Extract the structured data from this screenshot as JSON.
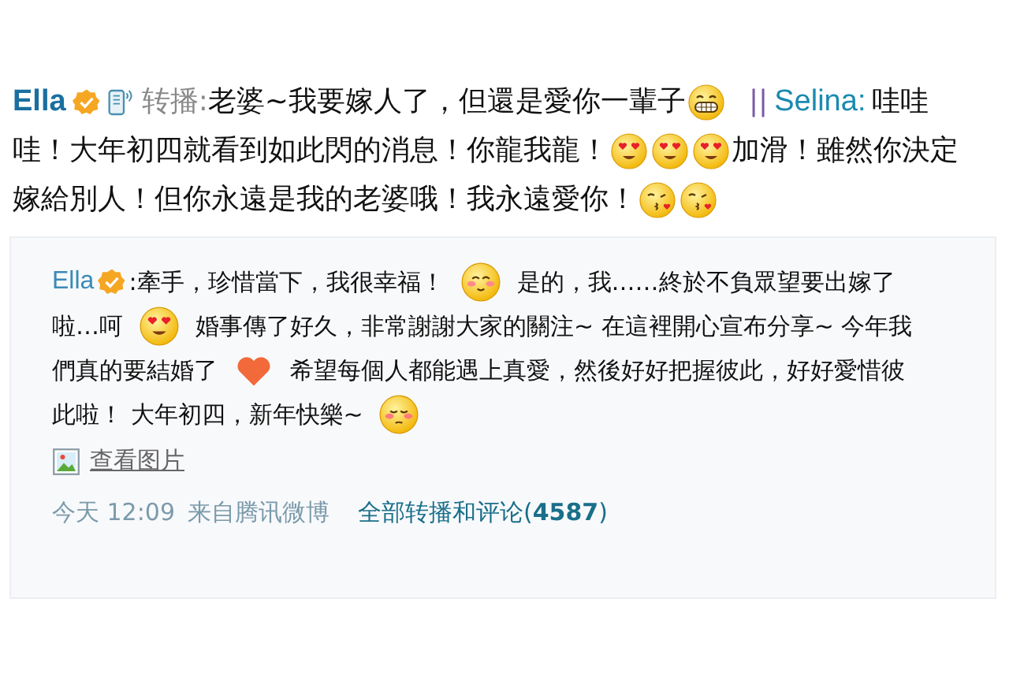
{
  "post": {
    "author": "Ella",
    "verified": true,
    "via_mobile": true,
    "action": "转播:",
    "lines": [
      [
        {
          "kind": "text",
          "text": "老婆~我要嫁人了，但還是愛你一輩子"
        },
        {
          "kind": "grin"
        },
        {
          "kind": "separator",
          "text": "||"
        },
        {
          "kind": "mention",
          "text": "Selina:"
        },
        {
          "kind": "text",
          "text": "哇哇"
        }
      ],
      [
        {
          "kind": "text",
          "text": "哇！大年初四就看到如此閃的消息！你龍我龍！"
        },
        {
          "kind": "hearteyes"
        },
        {
          "kind": "hearteyes"
        },
        {
          "kind": "hearteyes"
        },
        {
          "kind": "text",
          "text": "加滑！雖然你決定"
        }
      ],
      [
        {
          "kind": "text",
          "text": "嫁給別人！但你永遠是我的老婆哦！我永遠愛你！"
        },
        {
          "kind": "kiss"
        },
        {
          "kind": "kiss"
        }
      ]
    ]
  },
  "quote": {
    "author": "Ella",
    "verified": true,
    "lines": [
      [
        {
          "kind": "text",
          "text": ":"
        },
        {
          "kind": "text",
          "text": "牽手，珍惜當下，我很幸福！"
        },
        {
          "kind": "smile"
        },
        {
          "kind": "text",
          "text": "是的，我……終於不負眾望要出嫁了"
        }
      ],
      [
        {
          "kind": "text",
          "text": "啦…呵"
        },
        {
          "kind": "hearteyes"
        },
        {
          "kind": "text",
          "text": "婚事傳了好久，非常謝謝大家的關注~ 在這裡開心宣布分享~ 今年我"
        }
      ],
      [
        {
          "kind": "text",
          "text": "們真的要結婚了"
        },
        {
          "kind": "heart"
        },
        {
          "kind": "text",
          "text": "希望每個人都能遇上真愛，然後好好把握彼此，好好愛惜彼"
        }
      ],
      [
        {
          "kind": "text",
          "text": "此啦！ 大年初四，新年快樂~"
        },
        {
          "kind": "shy"
        }
      ]
    ],
    "image_link": "查看图片",
    "time": "今天 12:09",
    "source": "来自腾讯微博",
    "comments_link": "全部转播和评论(**4587**)"
  }
}
